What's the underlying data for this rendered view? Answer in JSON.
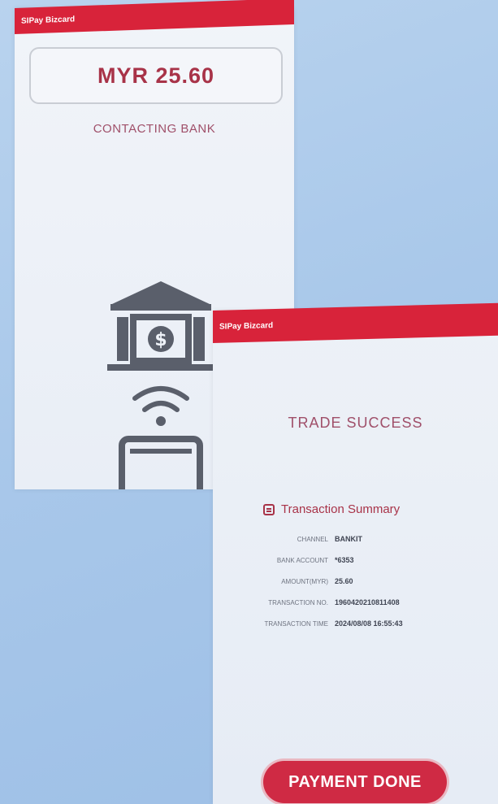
{
  "screen1": {
    "app_title": "SIPay Bizcard",
    "amount": "MYR 25.60",
    "status": "CONTACTING BANK",
    "illustration_icons": [
      "bank-icon",
      "dollar-icon",
      "wifi-icon",
      "phone-icon"
    ]
  },
  "screen2": {
    "app_title": "SIPay Bizcard",
    "result": "TRADE SUCCESS",
    "summary_title": "Transaction Summary",
    "summary_rows": [
      {
        "label": "CHANNEL",
        "value": "BANKIT"
      },
      {
        "label": "BANK ACCOUNT",
        "value": "*6353"
      },
      {
        "label": "AMOUNT(MYR)",
        "value": "25.60"
      },
      {
        "label": "TRANSACTION NO.",
        "value": "1960420210811408"
      },
      {
        "label": "TRANSACTION TIME",
        "value": "2024/08/08 16:55:43"
      }
    ],
    "button_label": "PAYMENT DONE"
  },
  "colors": {
    "accent": "#d8233a",
    "text_accent": "#a83348",
    "background": "#a9c8ea"
  }
}
